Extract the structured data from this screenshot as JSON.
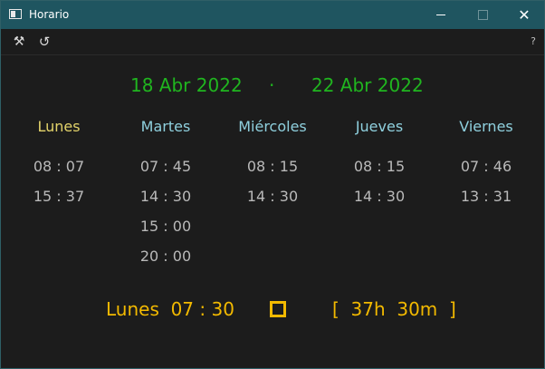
{
  "window": {
    "title": "Horario"
  },
  "titlebar": {
    "minimize_icon": "minimize-icon",
    "maximize_icon": "maximize-icon",
    "close_icon": "close-icon",
    "close_glyph": "✕"
  },
  "toolbar": {
    "tools_glyph": "⚒",
    "refresh_glyph": "↺",
    "help_glyph": "?"
  },
  "range": {
    "start": "18 Abr 2022",
    "separator": "·",
    "end": "22 Abr 2022"
  },
  "days": [
    {
      "name": "Lunes",
      "active": true,
      "times": [
        "08 : 07",
        "15 : 37"
      ]
    },
    {
      "name": "Martes",
      "active": false,
      "times": [
        "07 : 45",
        "14 : 30",
        "15 : 00",
        "20 : 00"
      ]
    },
    {
      "name": "Miércoles",
      "active": false,
      "times": [
        "08 : 15",
        "14 : 30"
      ]
    },
    {
      "name": "Jueves",
      "active": false,
      "times": [
        "08 : 15",
        "14 : 30"
      ]
    },
    {
      "name": "Viernes",
      "active": false,
      "times": [
        "07 : 46",
        "13 : 31"
      ]
    }
  ],
  "footer": {
    "next_label": "Lunes  07 : 30",
    "remaining_label": "[  37h  30m  ]"
  },
  "colors": {
    "range": "#20b51f",
    "active_day": "#e3d36a",
    "day": "#8fd0de",
    "time": "#b9b9b9",
    "accent": "#f2b900",
    "titlebar": "#1f5560"
  }
}
